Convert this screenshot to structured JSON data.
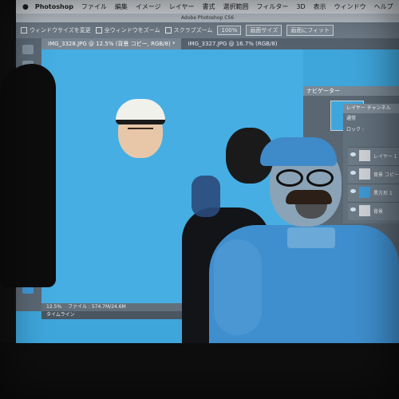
{
  "menu": {
    "apple": "",
    "items": [
      "Photoshop",
      "ファイル",
      "編集",
      "イメージ",
      "レイヤー",
      "書式",
      "選択範囲",
      "フィルター",
      "3D",
      "表示",
      "ウィンドウ",
      "ヘルプ"
    ]
  },
  "window_title": "Adobe Photoshop CS6",
  "options": {
    "resize_windows": "ウィンドウサイズを変更",
    "zoom_all": "全ウィンドウをズーム",
    "scrubby_zoom": "スクラブズーム",
    "zoom_percent": "100%",
    "screen_size_button": "画面サイズ",
    "fit_screen_button": "画面にフィット"
  },
  "tabs": [
    {
      "label": "IMG_3328.JPG @ 12.5% (背景 コピー, RGB/8) *"
    },
    {
      "label": "IMG_3327.JPG @ 16.7% (RGB/8)"
    }
  ],
  "status": {
    "zoom": "12.5%",
    "file_size": "ファイル : 574.7M/24.6M"
  },
  "timeline_label": "タイムライン",
  "navigator_label": "ナビゲーター",
  "layers_panel": {
    "tabs": "レイヤー チャンネル",
    "blend_mode": "通常",
    "lock_label": "ロック :",
    "layers": [
      {
        "name": "レイヤー 1"
      },
      {
        "name": "背景 コピー"
      },
      {
        "name": "黒方形 1"
      },
      {
        "name": "背景"
      }
    ]
  },
  "colors": {
    "screen_blue": "#3fa6dc",
    "ui_gray": "#5b6874"
  }
}
